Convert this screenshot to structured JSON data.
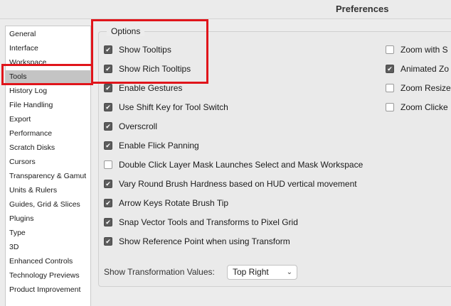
{
  "window": {
    "title": "Preferences"
  },
  "sidebar": {
    "items": [
      {
        "label": "General",
        "selected": false
      },
      {
        "label": "Interface",
        "selected": false
      },
      {
        "label": "Workspace",
        "selected": false
      },
      {
        "label": "Tools",
        "selected": true
      },
      {
        "label": "History Log",
        "selected": false
      },
      {
        "label": "File Handling",
        "selected": false
      },
      {
        "label": "Export",
        "selected": false
      },
      {
        "label": "Performance",
        "selected": false
      },
      {
        "label": "Scratch Disks",
        "selected": false
      },
      {
        "label": "Cursors",
        "selected": false
      },
      {
        "label": "Transparency & Gamut",
        "selected": false
      },
      {
        "label": "Units & Rulers",
        "selected": false
      },
      {
        "label": "Guides, Grid & Slices",
        "selected": false
      },
      {
        "label": "Plugins",
        "selected": false
      },
      {
        "label": "Type",
        "selected": false
      },
      {
        "label": "3D",
        "selected": false
      },
      {
        "label": "Enhanced Controls",
        "selected": false
      },
      {
        "label": "Technology Previews",
        "selected": false
      },
      {
        "label": "Product Improvement",
        "selected": false
      }
    ]
  },
  "options": {
    "legend": "Options",
    "left": [
      {
        "label": "Show Tooltips",
        "checked": true
      },
      {
        "label": "Show Rich Tooltips",
        "checked": true
      },
      {
        "label": "Enable Gestures",
        "checked": true
      },
      {
        "label": "Use Shift Key for Tool Switch",
        "checked": true
      },
      {
        "label": "Overscroll",
        "checked": true
      },
      {
        "label": "Enable Flick Panning",
        "checked": true
      },
      {
        "label": "Double Click Layer Mask Launches Select and Mask Workspace",
        "checked": false
      },
      {
        "label": "Vary Round Brush Hardness based on HUD vertical movement",
        "checked": true
      },
      {
        "label": "Arrow Keys Rotate Brush Tip",
        "checked": true
      },
      {
        "label": "Snap Vector Tools and Transforms to Pixel Grid",
        "checked": true
      },
      {
        "label": "Show Reference Point when using Transform",
        "checked": true
      }
    ],
    "right": [
      {
        "label": "Zoom with S",
        "checked": false
      },
      {
        "label": "Animated Zo",
        "checked": true
      },
      {
        "label": "Zoom Resize",
        "checked": false
      },
      {
        "label": "Zoom Clicke",
        "checked": false
      }
    ]
  },
  "transformation_values": {
    "label": "Show Transformation Values:",
    "selected": "Top Right"
  },
  "icons": {
    "check": "checkmark-icon",
    "dropdown": "chevron-down-icon"
  },
  "colors": {
    "highlight": "#e0151b",
    "selected_row": "#c4c4c4",
    "checkbox_on": "#5c5c5c"
  }
}
